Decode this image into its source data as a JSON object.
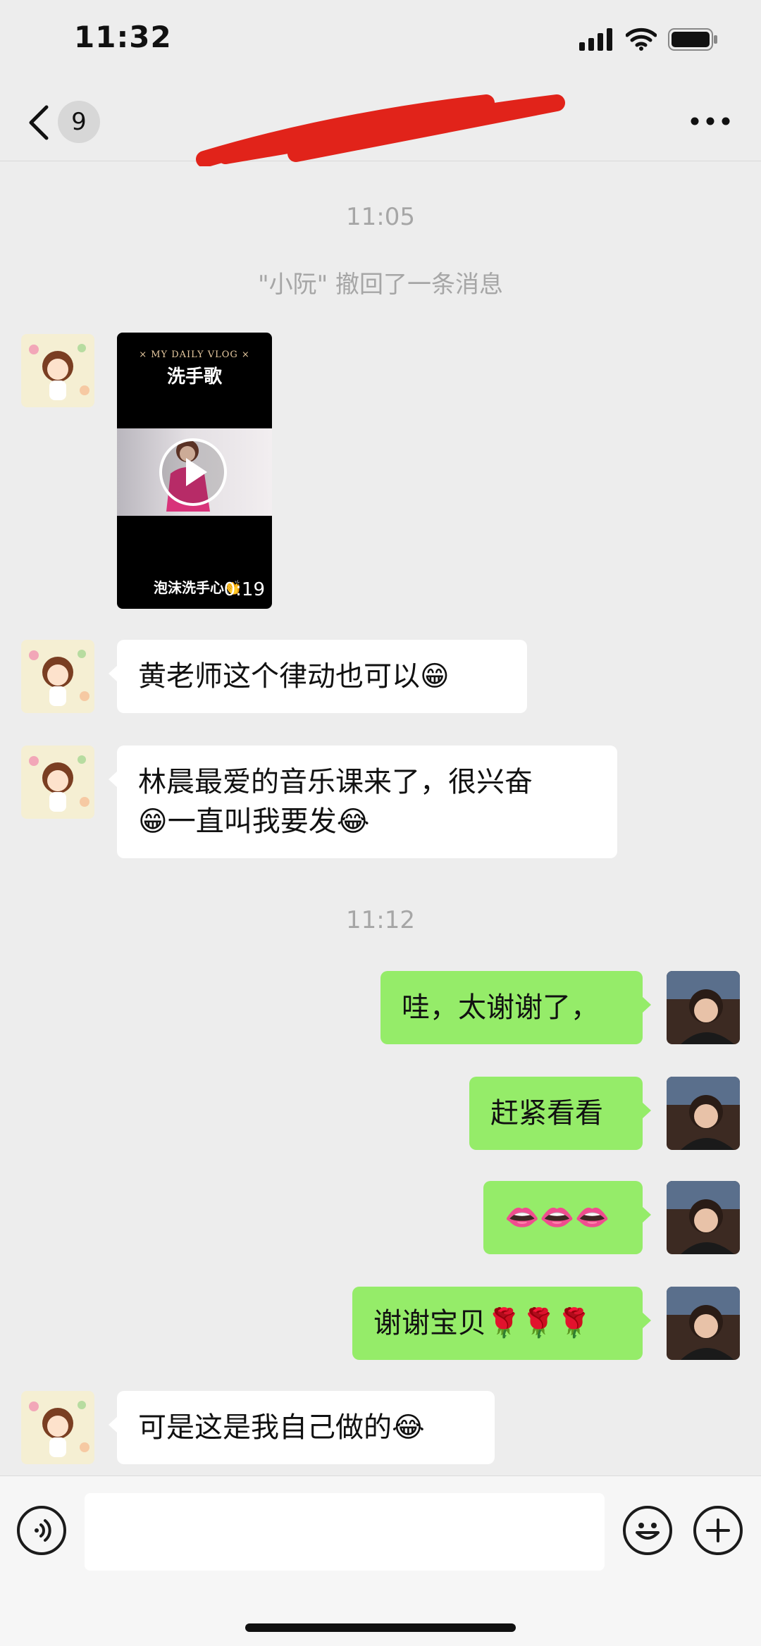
{
  "status": {
    "time": "11:32"
  },
  "header": {
    "unread_count": "9"
  },
  "messages": [
    {
      "kind": "time",
      "text": "11:05"
    },
    {
      "kind": "system",
      "text": "\"小阮\" 撤回了一条消息"
    },
    {
      "kind": "video",
      "title_small": "× MY DAILY VLOG ×",
      "title": "洗手歌",
      "subtitle": "泡沫洗手心👏",
      "duration": "0:19"
    },
    {
      "kind": "in",
      "text": "黄老师这个律动也可以😁"
    },
    {
      "kind": "in",
      "text": "林晨最爱的音乐课来了，很兴奋\n😁一直叫我要发😂"
    },
    {
      "kind": "time",
      "text": "11:12"
    },
    {
      "kind": "out",
      "text": "哇，太谢谢了，"
    },
    {
      "kind": "out",
      "text": "赶紧看看"
    },
    {
      "kind": "out",
      "text": "👄👄👄"
    },
    {
      "kind": "out",
      "text": "谢谢宝贝🌹🌹🌹"
    },
    {
      "kind": "in",
      "text": "可是这是我自己做的😂"
    }
  ],
  "colors": {
    "background": "#ededed",
    "bubble_in": "#ffffff",
    "bubble_out": "#95ec69",
    "timestamp": "#a6a6a6"
  },
  "icons": [
    "back-arrow-icon",
    "more-dots-icon",
    "voice-icon",
    "emoji-icon",
    "plus-icon"
  ]
}
